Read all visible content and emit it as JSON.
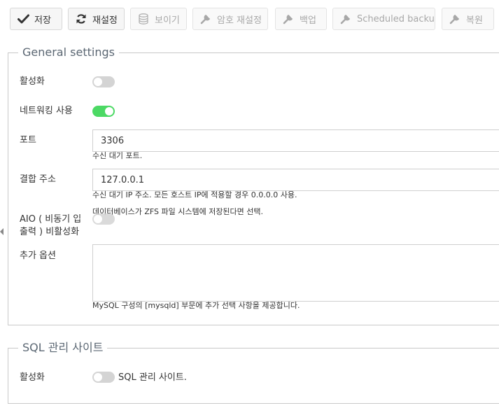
{
  "toolbar": {
    "save": "저장",
    "reset": "재설정",
    "view": "보이기",
    "password_reset": "암호 재설정",
    "backup": "백업",
    "scheduled_backup": "Scheduled backup",
    "restore": "복원"
  },
  "general": {
    "legend": "General settings",
    "enable_label": "활성화",
    "enable_on": false,
    "networking_label": "네트워킹 사용",
    "networking_on": true,
    "port_label": "포트",
    "port_value": "3306",
    "port_help": "수신 대기 포트.",
    "bind_label": "결합 주소",
    "bind_value": "127.0.0.1",
    "bind_help": "수신 대기 IP 주소. 모든 호스트 IP에 적용할 경우 0.0.0.0 사용.",
    "aio_label_line1": "AIO ( 비동기 입",
    "aio_label_line2": "출력 ) 비활성화",
    "aio_help": "데이터베이스가 ZFS 파일 시스템에 저장된다면 선택.",
    "aio_on": false,
    "extra_label": "추가 옵션",
    "extra_value": "",
    "extra_help": "MySQL 구성의 [mysqld] 부문에 추가 선택 사항을 제공합니다."
  },
  "sql_admin": {
    "legend": "SQL 관리 사이트",
    "enable_label": "활성화",
    "enable_on": false,
    "toggle_caption": "SQL 관리 사이트."
  },
  "colors": {
    "toggle_on": "#4cd964",
    "toggle_off": "#d4d4d4",
    "legend": "#5b6773"
  }
}
